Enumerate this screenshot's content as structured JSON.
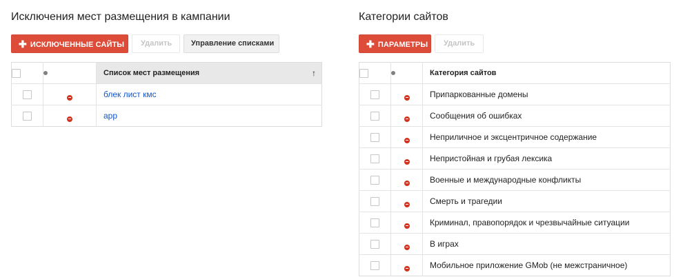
{
  "placements": {
    "title": "Исключения мест размещения в кампании",
    "add_button": "ИСКЛЮЧЕННЫЕ САЙТЫ",
    "delete_button": "Удалить",
    "manage_button": "Управление списками",
    "column_header": "Список мест размещения",
    "sort_indicator": "↑",
    "rows": [
      {
        "label": "блек лист кмс"
      },
      {
        "label": "app"
      }
    ]
  },
  "categories": {
    "title": "Категории сайтов",
    "add_button": "ПАРАМЕТРЫ",
    "delete_button": "Удалить",
    "column_header": "Категория сайтов",
    "rows": [
      {
        "label": "Припаркованные домены"
      },
      {
        "label": "Сообщения об ошибках"
      },
      {
        "label": "Неприличное и эксцентричное содержание"
      },
      {
        "label": "Непристойная и грубая лексика"
      },
      {
        "label": "Военные и международные конфликты"
      },
      {
        "label": "Смерть и трагедии"
      },
      {
        "label": "Криминал, правопорядок и чрезвычайные ситуации"
      },
      {
        "label": "В играх"
      },
      {
        "label": "Мобильное приложение GMob (не межстраничное)"
      }
    ]
  },
  "icons": {
    "add": "plus-icon",
    "status_header": "status-dot-icon",
    "row_status": "excluded-minus-icon",
    "sort": "sort-ascending-icon"
  },
  "colors": {
    "accent_red": "#dd4b39",
    "link_blue": "#1155cc",
    "excluded_red": "#d2321e"
  }
}
